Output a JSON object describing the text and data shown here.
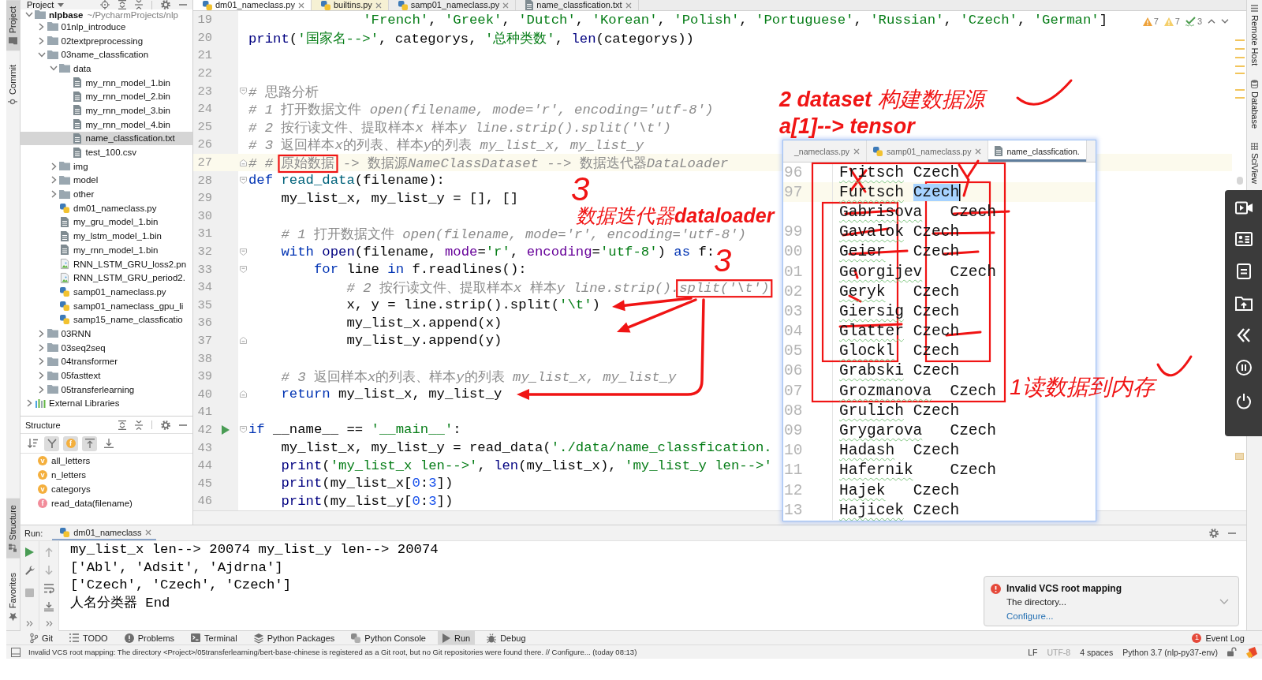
{
  "left_toolbar": {
    "top": [
      {
        "label": "Project",
        "kind": "project",
        "selected": true
      },
      {
        "label": "Commit",
        "kind": "commit",
        "selected": false
      }
    ],
    "bottom": [
      {
        "label": "Structure",
        "kind": "structure",
        "selected": true
      },
      {
        "label": "Favorites",
        "kind": "favorites",
        "selected": false
      }
    ]
  },
  "project": {
    "title": "Project",
    "tree": [
      {
        "label": "nlpbase",
        "path": "~/PycharmProjects/nlp",
        "kind": "folder",
        "expanded": true,
        "selected": false,
        "children": [
          {
            "label": "01nlp_introduce",
            "kind": "folder",
            "expanded": false,
            "selected": false
          },
          {
            "label": "02textpreprocessing",
            "kind": "folder",
            "expanded": false,
            "selected": false
          },
          {
            "label": "03name_classfication",
            "kind": "folder",
            "expanded": true,
            "selected": false,
            "children": [
              {
                "label": "data",
                "kind": "folder",
                "expanded": true,
                "selected": false,
                "children": [
                  {
                    "label": "my_rnn_model_1.bin",
                    "kind": "file",
                    "selected": false
                  },
                  {
                    "label": "my_rnn_model_2.bin",
                    "kind": "file",
                    "selected": false
                  },
                  {
                    "label": "my_rnn_model_3.bin",
                    "kind": "file",
                    "selected": false
                  },
                  {
                    "label": "my_rnn_model_4.bin",
                    "kind": "file",
                    "selected": false
                  },
                  {
                    "label": "name_classfication.txt",
                    "kind": "file",
                    "selected": true
                  },
                  {
                    "label": "test_100.csv",
                    "kind": "file",
                    "selected": false
                  }
                ]
              },
              {
                "label": "img",
                "kind": "folder",
                "expanded": false,
                "selected": false
              },
              {
                "label": "model",
                "kind": "folder",
                "expanded": false,
                "selected": false
              },
              {
                "label": "other",
                "kind": "folder",
                "expanded": false,
                "selected": false
              },
              {
                "label": "dm01_nameclass.py",
                "kind": "python",
                "selected": false
              },
              {
                "label": "my_gru_model_1.bin",
                "kind": "file",
                "selected": false
              },
              {
                "label": "my_lstm_model_1.bin",
                "kind": "file",
                "selected": false
              },
              {
                "label": "my_rnn_model_1.bin",
                "kind": "file",
                "selected": false
              },
              {
                "label": "RNN_LSTM_GRU_loss2.pn",
                "kind": "image",
                "selected": false
              },
              {
                "label": "RNN_LSTM_GRU_period2.",
                "kind": "image",
                "selected": false
              },
              {
                "label": "samp01_nameclass.py",
                "kind": "python",
                "selected": false
              },
              {
                "label": "samp01_nameclass_gpu_li",
                "kind": "python",
                "selected": false
              },
              {
                "label": "samp15_name_classficatio",
                "kind": "python",
                "selected": false
              }
            ]
          },
          {
            "label": "03RNN",
            "kind": "folder",
            "expanded": false,
            "selected": false
          },
          {
            "label": "03seq2seq",
            "kind": "folder",
            "expanded": false,
            "selected": false
          },
          {
            "label": "04transformer",
            "kind": "folder",
            "expanded": false,
            "selected": false
          },
          {
            "label": "05fasttext",
            "kind": "folder",
            "expanded": false,
            "selected": false
          },
          {
            "label": "05transferlearning",
            "kind": "folder",
            "expanded": false,
            "selected": false
          }
        ]
      },
      {
        "label": "External Libraries",
        "kind": "library",
        "expanded": false,
        "selected": false
      }
    ]
  },
  "structure": {
    "title": "Structure",
    "toolbar": [
      {
        "kind": "sort",
        "selected": false
      },
      {
        "kind": "filter",
        "selected": true
      },
      {
        "kind": "fields",
        "badge": "f",
        "selected": true
      },
      {
        "kind": "expand",
        "selected": true
      },
      {
        "kind": "collapse",
        "selected": false
      }
    ],
    "items": [
      {
        "kind": "variable",
        "badge": "v",
        "label": "all_letters"
      },
      {
        "kind": "variable",
        "badge": "v",
        "label": "n_letters"
      },
      {
        "kind": "variable",
        "badge": "v",
        "label": "categorys"
      },
      {
        "kind": "function",
        "badge": "f",
        "label": "read_data(filename)"
      }
    ]
  },
  "editor": {
    "tabs": [
      {
        "label": "dm01_nameclass.py",
        "kind": "python",
        "selected": true
      },
      {
        "label": "builtins.py",
        "kind": "library",
        "selected": false
      },
      {
        "label": "samp01_nameclass.py",
        "kind": "python",
        "selected": false
      },
      {
        "label": "name_classfication.txt",
        "kind": "text",
        "selected": false
      }
    ],
    "inspections": [
      {
        "kind": "warning",
        "count": "7"
      },
      {
        "kind": "weak_warning",
        "count": "7"
      },
      {
        "kind": "typo",
        "count": "3"
      }
    ],
    "lines": [
      {
        "number": "19",
        "kind": "continuation",
        "code": [
          {
            "kind": "string",
            "text": "'French'"
          },
          {
            "kind": "plain",
            "text": ", "
          },
          {
            "kind": "string",
            "text": "'Greek'"
          },
          {
            "kind": "plain",
            "text": ", "
          },
          {
            "kind": "string",
            "text": "'Dutch'"
          },
          {
            "kind": "plain",
            "text": ", "
          },
          {
            "kind": "string",
            "text": "'Korean'"
          },
          {
            "kind": "plain",
            "text": ", "
          },
          {
            "kind": "string",
            "text": "'Polish'"
          },
          {
            "kind": "plain",
            "text": ", "
          },
          {
            "kind": "string",
            "text": "'Portuguese'"
          },
          {
            "kind": "plain",
            "text": ", "
          },
          {
            "kind": "string",
            "text": "'Russian'"
          },
          {
            "kind": "plain",
            "text": ", "
          },
          {
            "kind": "string",
            "text": "'Czech'"
          },
          {
            "kind": "plain",
            "text": ", "
          },
          {
            "kind": "string",
            "text": "'German'"
          },
          {
            "kind": "plain",
            "text": "]"
          }
        ]
      },
      {
        "number": "20",
        "code": [
          {
            "kind": "builtin",
            "text": "print"
          },
          {
            "kind": "plain",
            "text": "("
          },
          {
            "kind": "string",
            "text": "'国家名-->'"
          },
          {
            "kind": "plain",
            "text": ", categorys, "
          },
          {
            "kind": "string",
            "text": "'总种类数'"
          },
          {
            "kind": "plain",
            "text": ", "
          },
          {
            "kind": "builtin",
            "text": "len"
          },
          {
            "kind": "plain",
            "text": "(categorys))"
          }
        ]
      },
      {
        "number": "21"
      },
      {
        "number": "22"
      },
      {
        "number": "23",
        "fold_start": true,
        "code": [
          {
            "kind": "comment",
            "text": "# 思路分析"
          }
        ]
      },
      {
        "number": "24",
        "code": [
          {
            "kind": "comment",
            "text": "# 1 打开数据文件 open(filename, mode='r', encoding='utf-8')"
          }
        ]
      },
      {
        "number": "25",
        "code": [
          {
            "kind": "comment",
            "text": "# 2 按行读文件、提取样本x 样本y line.strip().split('\\t')"
          }
        ]
      },
      {
        "number": "26",
        "code": [
          {
            "kind": "comment",
            "text": "# 3 返回样本x的列表、样本y的列表 my_list_x, my_list_y"
          }
        ]
      },
      {
        "number": "27",
        "fold_end": true,
        "current": true,
        "code": [
          {
            "kind": "comment",
            "text": "# # "
          },
          {
            "kind": "comment",
            "text": "原始数据",
            "circled": true
          },
          {
            "kind": "comment",
            "text": " -> 数据源NameClassDataset --> 数据迭代器DataLoader"
          }
        ]
      },
      {
        "number": "28",
        "fold_start": true,
        "code": [
          {
            "kind": "keyword",
            "text": "def "
          },
          {
            "kind": "function",
            "text": "read_data"
          },
          {
            "kind": "plain",
            "text": "(filename):"
          }
        ],
        "children": [
          {
            "number": "29",
            "code": [
              {
                "kind": "plain",
                "text": "my_list_x, my_list_y = [], []"
              }
            ]
          },
          {
            "number": "30"
          },
          {
            "number": "31",
            "code": [
              {
                "kind": "comment",
                "text": "# 1 打开数据文件 open(filename, mode='r', encoding='utf-8')"
              }
            ]
          },
          {
            "number": "32",
            "fold_start": true,
            "code": [
              {
                "kind": "keyword",
                "text": "with "
              },
              {
                "kind": "builtin",
                "text": "open"
              },
              {
                "kind": "plain",
                "text": "(filename, "
              },
              {
                "kind": "param",
                "text": "mode"
              },
              {
                "kind": "plain",
                "text": "="
              },
              {
                "kind": "string",
                "text": "'r'"
              },
              {
                "kind": "plain",
                "text": ", "
              },
              {
                "kind": "param",
                "text": "encoding"
              },
              {
                "kind": "plain",
                "text": "="
              },
              {
                "kind": "string",
                "text": "'utf-8'"
              },
              {
                "kind": "plain",
                "text": ") "
              },
              {
                "kind": "keyword",
                "text": "as"
              },
              {
                "kind": "plain",
                "text": " f:"
              }
            ],
            "children": [
              {
                "number": "33",
                "fold_start": true,
                "code": [
                  {
                    "kind": "keyword",
                    "text": "for"
                  },
                  {
                    "kind": "plain",
                    "text": " line "
                  },
                  {
                    "kind": "keyword",
                    "text": "in"
                  },
                  {
                    "kind": "plain",
                    "text": " f.readlines():"
                  }
                ],
                "children": [
                  {
                    "number": "34",
                    "code": [
                      {
                        "kind": "comment",
                        "text": "# 2 按行读文件、提取样本x 样本y line.strip()."
                      },
                      {
                        "kind": "comment",
                        "text": "split('\\t')",
                        "circled": true
                      }
                    ]
                  },
                  {
                    "number": "35",
                    "code": [
                      {
                        "kind": "plain",
                        "text": "x, y = line.strip().split("
                      },
                      {
                        "kind": "string",
                        "text": "'\\t'"
                      },
                      {
                        "kind": "plain",
                        "text": ")"
                      }
                    ]
                  },
                  {
                    "number": "36",
                    "code": [
                      {
                        "kind": "plain",
                        "text": "my_list_x.append(x)"
                      }
                    ]
                  },
                  {
                    "number": "37",
                    "fold_end": true,
                    "code": [
                      {
                        "kind": "plain",
                        "text": "my_list_y.append(y)"
                      }
                    ]
                  }
                ]
              }
            ]
          },
          {
            "number": "38"
          },
          {
            "number": "39",
            "code": [
              {
                "kind": "comment",
                "text": "# 3 返回样本x的列表、样本y的列表 my_list_x, my_list_y"
              }
            ]
          },
          {
            "number": "40",
            "fold_end": true,
            "code": [
              {
                "kind": "keyword",
                "text": "return"
              },
              {
                "kind": "plain",
                "text": " my_list_x, my_list_y"
              }
            ]
          }
        ]
      },
      {
        "number": "41"
      },
      {
        "number": "42",
        "run": true,
        "fold_start": true,
        "code": [
          {
            "kind": "keyword",
            "text": "if"
          },
          {
            "kind": "plain",
            "text": " __name__ == "
          },
          {
            "kind": "string",
            "text": "'__main__'"
          },
          {
            "kind": "plain",
            "text": ":"
          }
        ],
        "children": [
          {
            "number": "43",
            "code": [
              {
                "kind": "plain",
                "text": "my_list_x, my_list_y = read_data("
              },
              {
                "kind": "string",
                "text": "'./data/name_classfication."
              }
            ]
          },
          {
            "number": "44",
            "code": [
              {
                "kind": "builtin",
                "text": "print"
              },
              {
                "kind": "plain",
                "text": "("
              },
              {
                "kind": "string",
                "text": "'my_list_x len-->'"
              },
              {
                "kind": "plain",
                "text": ", "
              },
              {
                "kind": "builtin",
                "text": "len"
              },
              {
                "kind": "plain",
                "text": "(my_list_x), "
              },
              {
                "kind": "string",
                "text": "'my_list_y len-->'"
              }
            ]
          },
          {
            "number": "45",
            "code": [
              {
                "kind": "builtin",
                "text": "print"
              },
              {
                "kind": "plain",
                "text": "(my_list_x["
              },
              {
                "kind": "number",
                "text": "0"
              },
              {
                "kind": "plain",
                "text": ":"
              },
              {
                "kind": "number",
                "text": "3"
              },
              {
                "kind": "plain",
                "text": "])"
              }
            ]
          },
          {
            "number": "46",
            "code": [
              {
                "kind": "builtin",
                "text": "print"
              },
              {
                "kind": "plain",
                "text": "(my_list_y["
              },
              {
                "kind": "number",
                "text": "0"
              },
              {
                "kind": "plain",
                "text": ":"
              },
              {
                "kind": "number",
                "text": "3"
              },
              {
                "kind": "plain",
                "text": "])"
              }
            ]
          }
        ]
      }
    ]
  },
  "right_toolbar": [
    {
      "label": "Remote Host",
      "kind": "remote"
    },
    {
      "label": "Database",
      "kind": "database"
    },
    {
      "label": "SciView",
      "kind": "sciview"
    }
  ],
  "run": {
    "label": "Run:",
    "tab": "dm01_nameclass",
    "output": [
      "my_list_x len--> 20074 my_list_y len--> 20074",
      "['Abl', 'Adsit', 'Ajdrna']",
      "['Czech', 'Czech', 'Czech']",
      "人名分类器 End"
    ]
  },
  "notification": {
    "title": "Invalid VCS root mapping",
    "body": "The directory...",
    "link": "Configure..."
  },
  "tool_windows": [
    {
      "label": "Git",
      "kind": "git",
      "selected": false
    },
    {
      "label": "TODO",
      "kind": "todo",
      "selected": false
    },
    {
      "label": "Problems",
      "kind": "problems",
      "selected": false
    },
    {
      "label": "Terminal",
      "kind": "terminal",
      "selected": false
    },
    {
      "label": "Python Packages",
      "kind": "packages",
      "selected": false
    },
    {
      "label": "Python Console",
      "kind": "console",
      "selected": false
    },
    {
      "label": "Run",
      "kind": "run",
      "selected": true
    },
    {
      "label": "Debug",
      "kind": "debug",
      "selected": false
    }
  ],
  "event_log": {
    "label": "Event Log",
    "badge": "1"
  },
  "status_bar": {
    "message": "Invalid VCS root mapping: The directory <Project>/05transferlearning/bert-base-chinese is registered as a Git root, but no Git repositories were found there. // Configure... (today 08:13)",
    "items": [
      {
        "label": "LF",
        "disabled": false
      },
      {
        "label": "UTF-8",
        "disabled": true
      },
      {
        "label": "4 spaces",
        "disabled": false
      },
      {
        "label": "Python 3.7 (nlp-py37-env)",
        "disabled": false
      }
    ]
  },
  "snippet": {
    "tabs": [
      {
        "label": "_nameclass.py",
        "kind": "python",
        "selected": false,
        "closable": true
      },
      {
        "label": "samp01_nameclass.py",
        "kind": "python",
        "selected": false,
        "closable": true
      },
      {
        "label": "name_classfication.",
        "kind": "text",
        "selected": true,
        "closable": false
      }
    ],
    "rows": [
      {
        "line": "96",
        "name": "Fritsch",
        "country": "Czech",
        "current": false,
        "country_selected": false
      },
      {
        "line": "97",
        "name": "Furtsch",
        "country": "Czech",
        "current": true,
        "country_selected": true
      },
      {
        "name": "Gabrisova",
        "country": "Czech",
        "current": false,
        "country_selected": false
      },
      {
        "line": "99",
        "name": "Gavalok",
        "country": "Czech",
        "current": false,
        "country_selected": false
      },
      {
        "line": "00",
        "name": "Geier",
        "country": "Czech",
        "current": false,
        "country_selected": false
      },
      {
        "line": "01",
        "name": "Georgijev",
        "country": "Czech",
        "current": false,
        "country_selected": false
      },
      {
        "line": "02",
        "name": "Geryk",
        "country": "Czech",
        "current": false,
        "country_selected": false
      },
      {
        "line": "03",
        "name": "Giersig",
        "country": "Czech",
        "current": false,
        "country_selected": false
      },
      {
        "line": "04",
        "name": "Glatter",
        "country": "Czech",
        "current": false,
        "country_selected": false
      },
      {
        "line": "05",
        "name": "Glockl",
        "country": "Czech",
        "current": false,
        "country_selected": false
      },
      {
        "line": "06",
        "name": "Grabski",
        "country": "Czech",
        "current": false,
        "country_selected": false
      },
      {
        "line": "07",
        "name": "Grozmanova",
        "country": "Czech",
        "current": false,
        "country_selected": false
      },
      {
        "line": "08",
        "name": "Grulich",
        "country": "Czech",
        "current": false,
        "country_selected": false
      },
      {
        "line": "09",
        "name": "Grygarova",
        "country": "Czech",
        "current": false,
        "country_selected": false
      },
      {
        "line": "10",
        "name": "Hadash",
        "country": "Czech",
        "current": false,
        "country_selected": false
      },
      {
        "line": "11",
        "name": "Hafernik",
        "country": "Czech",
        "current": false,
        "country_selected": false
      },
      {
        "line": "12",
        "name": "Hajek",
        "country": "Czech",
        "current": false,
        "country_selected": false
      },
      {
        "line": "13",
        "name": "Hajicek",
        "country": "Czech",
        "current": false,
        "country_selected": false
      }
    ]
  },
  "annotations": [
    {
      "kind": "note",
      "text": "**2 dataset** 构建数据源"
    },
    {
      "kind": "label",
      "text": "a[1]--> tensor"
    },
    {
      "kind": "numeral",
      "text": "3"
    },
    {
      "kind": "note",
      "text": "数据迭代器**dataloader**"
    },
    {
      "kind": "numeral",
      "text": "3"
    },
    {
      "kind": "note",
      "text": "1读数据到内存"
    }
  ]
}
